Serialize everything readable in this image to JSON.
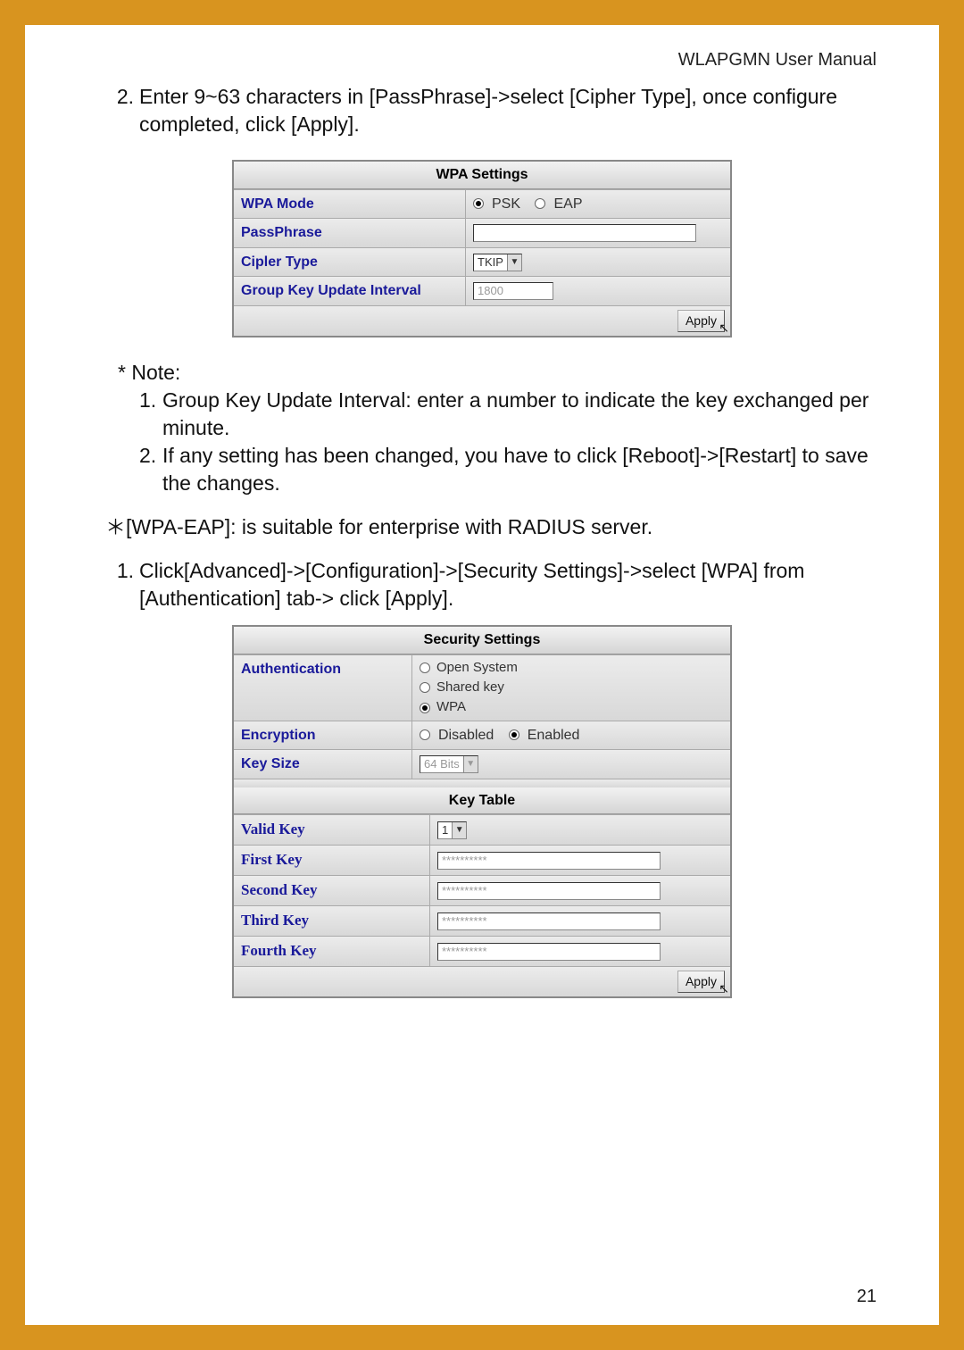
{
  "header": {
    "manual_title": "WLAPGMN User Manual"
  },
  "step2": {
    "num": "2.",
    "text": "Enter 9~63 characters in [PassPhrase]->select [Cipher Type], once configure completed, click [Apply]."
  },
  "wpa": {
    "title": "WPA Settings",
    "mode_label": "WPA Mode",
    "mode_psk": "PSK",
    "mode_eap": "EAP",
    "passphrase_label": "PassPhrase",
    "cipher_label": "Cipler Type",
    "cipher_value": "TKIP",
    "interval_label": "Group Key Update Interval",
    "interval_value": "1800",
    "apply": "Apply"
  },
  "note": {
    "head": "* Note:",
    "n1num": "1.",
    "n1": "Group Key Update Interval: enter a number to indicate the key exchanged per minute.",
    "n2num": "2.",
    "n2": "If any setting has been changed, you have to click [Reboot]->[Restart] to save the changes."
  },
  "wpaeap_line": "＊[WPA-EAP]: is suitable for enterprise with RADIUS server.",
  "step1b": {
    "num": "1.",
    "text": "Click[Advanced]->[Configuration]->[Security Settings]->select [WPA] from [Authentication] tab-> click [Apply]."
  },
  "sec": {
    "title": "Security Settings",
    "auth_label": "Authentication",
    "auth_open": "Open System",
    "auth_shared": "Shared key",
    "auth_wpa": "WPA",
    "enc_label": "Encryption",
    "enc_disabled": "Disabled",
    "enc_enabled": "Enabled",
    "keysize_label": "Key Size",
    "keysize_value": "64 Bits",
    "keytable_title": "Key Table",
    "valid_key_label": "Valid Key",
    "valid_key_value": "1",
    "first_label": "First Key",
    "second_label": "Second Key",
    "third_label": "Third Key",
    "fourth_label": "Fourth Key",
    "key_mask": "**********",
    "apply": "Apply"
  },
  "page_number": "21"
}
